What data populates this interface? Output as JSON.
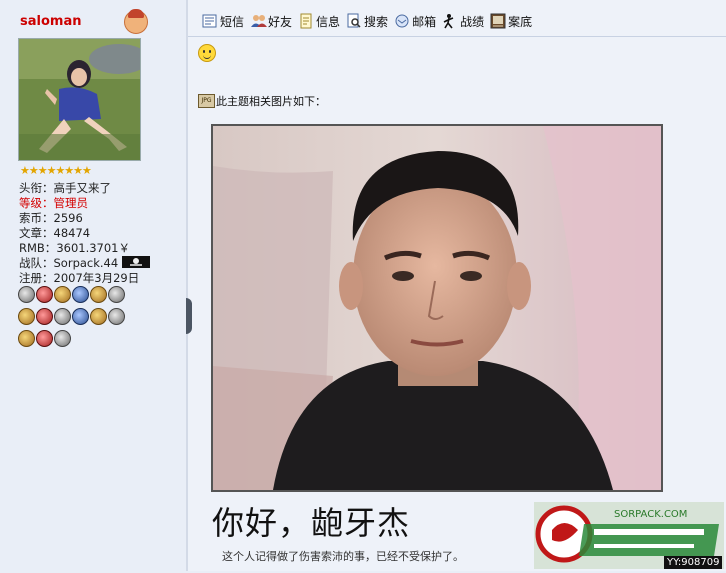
{
  "user": {
    "name": "saloman",
    "stars": "★★★★★★★★",
    "title_label": "头衔：",
    "title_value": "高手又来了",
    "level_label": "等级：",
    "level_value": "管理员",
    "coins_label": "索币：",
    "coins_value": "2596",
    "posts_label": "文章：",
    "posts_value": "48474",
    "rmb_label": "RMB：",
    "rmb_value": "3601.3701￥",
    "team_label": "战队：",
    "team_value": "Sorpack.44",
    "reg_label": "注册：",
    "reg_value": "2007年3月29日"
  },
  "toolbar": {
    "items": [
      {
        "label": "短信",
        "icon": "message-icon"
      },
      {
        "label": "好友",
        "icon": "friends-icon"
      },
      {
        "label": "信息",
        "icon": "info-icon"
      },
      {
        "label": "搜索",
        "icon": "search-icon"
      },
      {
        "label": "邮箱",
        "icon": "mail-icon"
      },
      {
        "label": "战绩",
        "icon": "record-icon"
      },
      {
        "label": "案底",
        "icon": "case-file-icon"
      }
    ]
  },
  "post": {
    "related_text": "此主题相关图片如下：",
    "jpg_badge": "JPG",
    "caption_big": "你好，龅牙杰",
    "caption_small": "这个人记得做了伤害索沛的事，已经不受保护了。"
  },
  "watermark": {
    "brand": "SORPACK.COM",
    "id_text": "YY:908709"
  },
  "colors": {
    "accent_red": "#cc0000",
    "page_bg": "#e9eef7"
  }
}
